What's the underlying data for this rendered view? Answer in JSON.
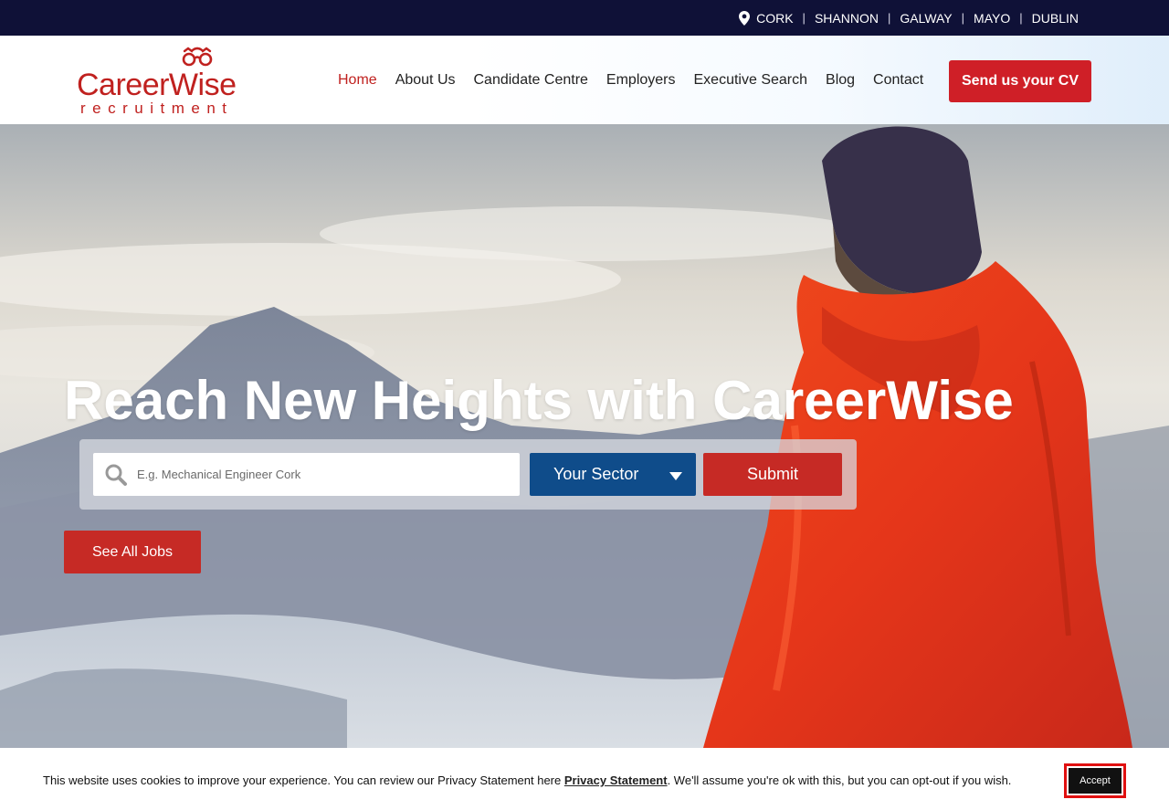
{
  "topbar": {
    "locations": [
      "CORK",
      "SHANNON",
      "GALWAY",
      "MAYO",
      "DUBLIN"
    ],
    "separator": "|",
    "icon": "map-pin-icon"
  },
  "header": {
    "logo_word": "CareerWise",
    "logo_sub": "recruitment",
    "nav": [
      "Home",
      "About Us",
      "Candidate Centre",
      "Employers",
      "Executive Search",
      "Blog",
      "Contact"
    ],
    "active_nav": "Home",
    "cv_button": "Send us your CV"
  },
  "hero": {
    "headline": "Reach New Heights with CareerWise",
    "search_placeholder": "E.g. Mechanical Engineer Cork",
    "sector_label": "Your Sector",
    "submit_label": "Submit",
    "see_all_label": "See All Jobs"
  },
  "cookie": {
    "text_before": "This website uses cookies to improve your experience. You can review our Privacy Statement here ",
    "link_label": "Privacy Statement",
    "text_after": ". We'll assume you're ok with this, but you can opt-out if you wish.",
    "accept_label": "Accept"
  },
  "colors": {
    "topbar": "#0f1137",
    "brand_red": "#c0211f",
    "sector_blue": "#0f4c8a",
    "button_red": "#c62a25"
  }
}
